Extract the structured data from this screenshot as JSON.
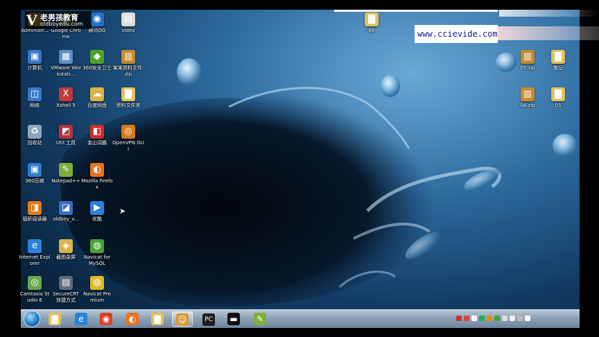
{
  "brand": {
    "mark": "V",
    "name": "老男孩教育",
    "site": "oldboyedu.com"
  },
  "watermark": "www.ccievide.com",
  "desktop_icons": [
    {
      "id": "administrator",
      "label": "Administr...",
      "icon": "user-folder-icon",
      "color": "#d9b54a",
      "glyph": "📁"
    },
    {
      "id": "chrome-shortcut",
      "label": "Google Chrome",
      "icon": "chrome-icon",
      "color": "#3a8f3a",
      "glyph": "●"
    },
    {
      "id": "qq",
      "label": "腾讯QQ",
      "icon": "qq-icon",
      "color": "#2a6fc9",
      "glyph": "◉"
    },
    {
      "id": "video-file",
      "label": "video",
      "icon": "file-icon",
      "color": "#ddd",
      "glyph": "▤"
    },
    {
      "id": "computer",
      "label": "计算机",
      "icon": "computer-icon",
      "color": "#3a78c9",
      "glyph": "▣"
    },
    {
      "id": "vmware",
      "label": "VMware Workstati...",
      "icon": "vmware-icon",
      "color": "#5c8fc4",
      "glyph": "▦"
    },
    {
      "id": "tool-a",
      "label": "360安全卫士",
      "icon": "shield-icon",
      "color": "#4ba32a",
      "glyph": "◆"
    },
    {
      "id": "zip-a",
      "label": "某某资料文件.zip",
      "icon": "archive-icon",
      "color": "#c68b2d",
      "glyph": "▥"
    },
    {
      "id": "network",
      "label": "网络",
      "icon": "network-icon",
      "color": "#3a78c9",
      "glyph": "◫"
    },
    {
      "id": "xshell",
      "label": "Xshell 5",
      "icon": "xshell-icon",
      "color": "#c03a3a",
      "glyph": "X"
    },
    {
      "id": "baidu",
      "label": "百度网盘",
      "icon": "cloud-icon",
      "color": "#d9b54a",
      "glyph": "☁"
    },
    {
      "id": "folder-a",
      "label": "资料文件夹",
      "icon": "folder-icon",
      "color": "#e2c15a",
      "glyph": "▇"
    },
    {
      "id": "recycle",
      "label": "回收站",
      "icon": "recycle-bin-icon",
      "color": "#8fa5bd",
      "glyph": "♻"
    },
    {
      "id": "tool-b",
      "label": "Util 工具",
      "icon": "app-icon",
      "color": "#b0343a",
      "glyph": "◩"
    },
    {
      "id": "tool-c",
      "label": "金山词霸",
      "icon": "dict-icon",
      "color": "#c8302d",
      "glyph": "◧"
    },
    {
      "id": "openvpn",
      "label": "OpenVPN GUI",
      "icon": "openvpn-icon",
      "color": "#d77a1c",
      "glyph": "◎"
    },
    {
      "id": "tool-d",
      "label": "360压缩",
      "icon": "archive-icon",
      "color": "#2f7bc6",
      "glyph": "▣"
    },
    {
      "id": "notepad",
      "label": "Notepad++",
      "icon": "notepad-icon",
      "color": "#7fae3a",
      "glyph": "✎"
    },
    {
      "id": "firefox",
      "label": "Mozilla Firefox",
      "icon": "firefox-icon",
      "color": "#e8731c",
      "glyph": "◐"
    },
    {
      "id": "reader",
      "label": "福昕阅读器",
      "icon": "reader-icon",
      "color": "#e27a1a",
      "glyph": "◨"
    },
    {
      "id": "oldboy",
      "label": "oldboy_v...",
      "icon": "app-icon",
      "color": "#3b6ec2",
      "glyph": "◪"
    },
    {
      "id": "youku",
      "label": "优酷",
      "icon": "youku-icon",
      "color": "#2f7fdc",
      "glyph": "▶"
    },
    {
      "id": "ie",
      "label": "Internet Explorer",
      "icon": "ie-icon",
      "color": "#2a82d8",
      "glyph": "e"
    },
    {
      "id": "tool-e",
      "label": "截图录屏",
      "icon": "camera-icon",
      "color": "#d9b54a",
      "glyph": "◈"
    },
    {
      "id": "navicat-mysql",
      "label": "Navicat for MySQL",
      "icon": "navicat-icon",
      "color": "#4aa33a",
      "glyph": "◍"
    },
    {
      "id": "camtasia",
      "label": "Camtasia Studio 6",
      "icon": "camtasia-icon",
      "color": "#6aa84f",
      "glyph": "◎"
    },
    {
      "id": "securecrt",
      "label": "SecureCRT 快捷方式",
      "icon": "securecrt-icon",
      "color": "#5d6d7e",
      "glyph": "▤"
    },
    {
      "id": "navicat-premium",
      "label": "Navicat Premium",
      "icon": "navicat-icon",
      "color": "#e0b92a",
      "glyph": "◍"
    },
    {
      "id": "file-86",
      "label": "86",
      "icon": "file-icon",
      "color": "#e2c15a",
      "glyph": "▇"
    },
    {
      "id": "zip-r1",
      "label": "05.zip",
      "icon": "archive-icon",
      "color": "#c68b2d",
      "glyph": "▥"
    },
    {
      "id": "folder-r1",
      "label": "笔记",
      "icon": "folder-icon",
      "color": "#e2c15a",
      "glyph": "▇"
    },
    {
      "id": "zip-r2",
      "label": "04.zip",
      "icon": "archive-icon",
      "color": "#c68b2d",
      "glyph": "▥"
    },
    {
      "id": "folder-r2",
      "label": "05",
      "icon": "folder-icon",
      "color": "#e2c15a",
      "glyph": "▇"
    }
  ],
  "taskbar": {
    "buttons": [
      {
        "id": "explorer-app",
        "icon": "explorer-icon",
        "glyph": "▇",
        "color": "#e2c15a"
      },
      {
        "id": "ie-app",
        "icon": "ie-icon",
        "glyph": "e",
        "color": "#2a82d8"
      },
      {
        "id": "chrome-app",
        "icon": "chrome-icon",
        "glyph": "◉",
        "color": "#d9402c"
      },
      {
        "id": "firefox-app",
        "icon": "firefox-icon",
        "glyph": "◐",
        "color": "#e8731c"
      },
      {
        "id": "folder-app",
        "icon": "folder-icon",
        "glyph": "▇",
        "color": "#e2c15a"
      },
      {
        "id": "photo-app",
        "icon": "people-icon",
        "glyph": "☺",
        "color": "#d99a3a",
        "active": true
      },
      {
        "id": "pycharm-app",
        "icon": "pycharm-icon",
        "glyph": "PC",
        "color": "#1f1f1f"
      },
      {
        "id": "terminal-app",
        "icon": "terminal-icon",
        "glyph": "▬",
        "color": "#111"
      },
      {
        "id": "notepad-app",
        "icon": "notepad-icon",
        "glyph": "✎",
        "color": "#7fae3a"
      }
    ],
    "tray_icons": [
      "s-icon",
      "red-icon",
      "flag-icon",
      "shield-icon",
      "orange-icon",
      "green-icon",
      "network-icon",
      "volume-icon",
      "wifi-icon",
      "info-icon"
    ]
  }
}
